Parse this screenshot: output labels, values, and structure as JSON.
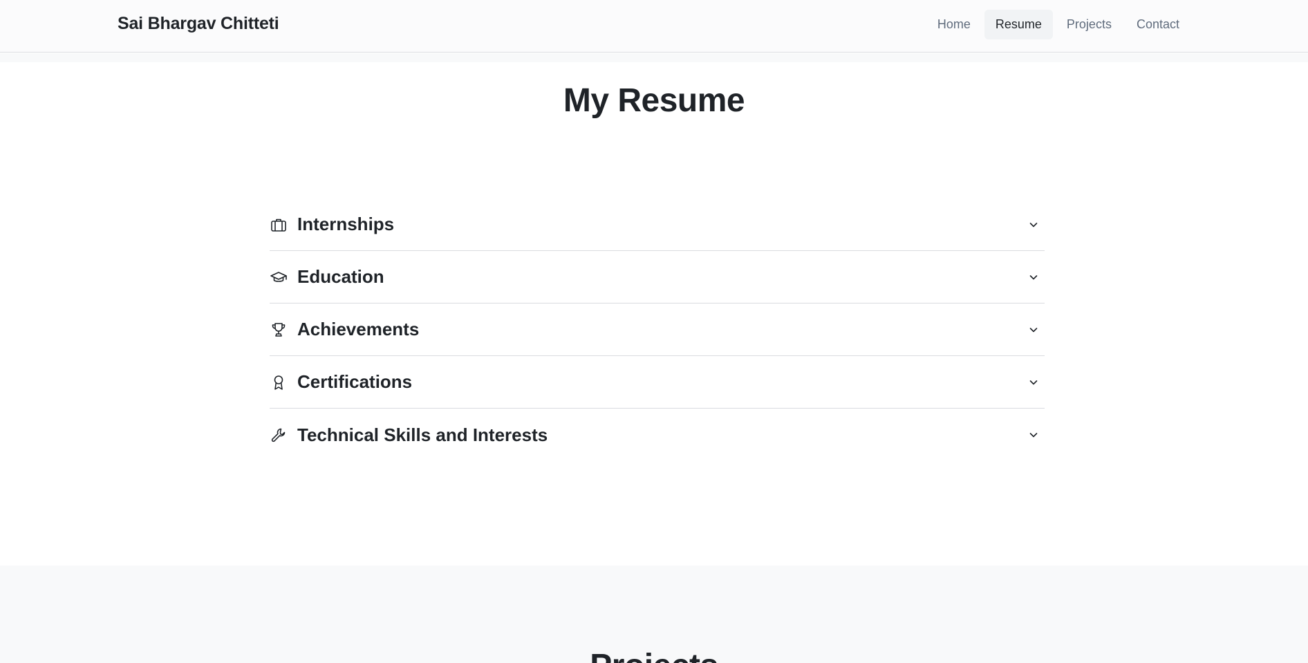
{
  "brand": {
    "name": "Sai Bhargav Chitteti"
  },
  "nav": {
    "items": [
      {
        "label": "Home"
      },
      {
        "label": "Resume",
        "active": true
      },
      {
        "label": "Projects"
      },
      {
        "label": "Contact"
      }
    ]
  },
  "resume": {
    "title": "My Resume",
    "sections": [
      {
        "label": "Internships",
        "icon": "briefcase-icon"
      },
      {
        "label": "Education",
        "icon": "graduation-cap-icon"
      },
      {
        "label": "Achievements",
        "icon": "trophy-icon"
      },
      {
        "label": "Certifications",
        "icon": "award-ribbon-icon"
      },
      {
        "label": "Technical Skills and Interests",
        "icon": "wrench-icon"
      }
    ]
  },
  "projects": {
    "title": "Projects"
  },
  "colors": {
    "text": "#1f2328",
    "nav_text": "#5f6b7c",
    "nav_bg": "#fbfbfc",
    "alt_section_bg": "#f8f9fa",
    "divider": "#d9dbdf"
  }
}
